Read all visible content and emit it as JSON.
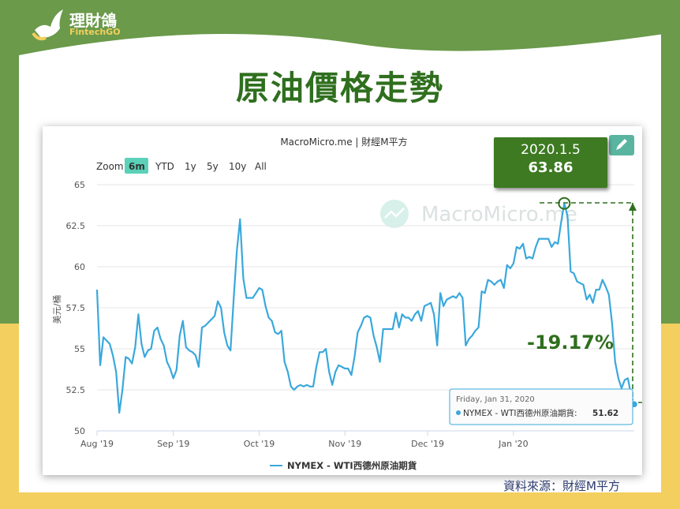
{
  "logo": {
    "name": "理財鴿",
    "sub": "FintechGO"
  },
  "title": "原油價格走勢",
  "source": "資料來源：財經M平方",
  "chart_header": "MacroMicro.me | 財經M平方",
  "watermark": "MacroMicro.me",
  "zoom": {
    "label": "Zoom",
    "options": [
      "6m",
      "YTD",
      "1y",
      "5y",
      "10y",
      "All"
    ],
    "active": "6m"
  },
  "ylabel": "美元/桶",
  "legend": "NYMEX - WTI西德州原油期貨",
  "tooltip": {
    "date": "Friday, Jan 31, 2020",
    "series": "NYMEX - WTI西德州原油期貨:",
    "value": "51.62"
  },
  "callout": {
    "date": "2020.1.5",
    "value": "63.86"
  },
  "change": "-19.17%",
  "colors": {
    "line": "#3aa8dc",
    "accent": "#2f6f1e",
    "callout_bg": "#3d7a22"
  },
  "chart_data": {
    "type": "line",
    "ylim": [
      50,
      65
    ],
    "yticks": [
      "50",
      "52.5",
      "55",
      "57.5",
      "60",
      "62.5",
      "65"
    ],
    "xtick_labels": [
      "Aug '19",
      "Sep '19",
      "Oct '19",
      "Nov '19",
      "Dec '19",
      "Jan '20"
    ],
    "series": [
      {
        "name": "NYMEX - WTI西德州原油期貨",
        "values": [
          58.6,
          54.0,
          55.7,
          55.5,
          55.3,
          54.6,
          53.6,
          51.1,
          52.5,
          54.5,
          54.4,
          54.1,
          55.1,
          57.1,
          55.3,
          54.5,
          54.9,
          55.0,
          56.1,
          56.3,
          55.6,
          55.2,
          54.2,
          53.8,
          53.2,
          53.7,
          55.8,
          56.7,
          55.1,
          54.9,
          54.8,
          54.6,
          53.9,
          56.3,
          56.4,
          56.6,
          56.8,
          57.0,
          57.9,
          57.5,
          56.0,
          55.2,
          54.9,
          58.1,
          61.0,
          62.9,
          59.3,
          58.1,
          58.1,
          58.1,
          58.4,
          58.7,
          58.6,
          57.6,
          56.9,
          56.7,
          56.0,
          55.9,
          56.1,
          54.2,
          53.6,
          52.7,
          52.5,
          52.7,
          52.8,
          52.7,
          52.8,
          52.7,
          52.7,
          53.9,
          54.8,
          54.8,
          55.0,
          53.6,
          52.8,
          53.6,
          54.0,
          53.9,
          53.8,
          53.8,
          53.4,
          54.5,
          56.0,
          56.4,
          56.9,
          57.0,
          56.9,
          55.8,
          55.1,
          54.2,
          56.2,
          56.2,
          56.2,
          56.2,
          57.2,
          56.3,
          57.1,
          56.9,
          56.9,
          56.7,
          57.1,
          57.3,
          56.7,
          57.6,
          57.7,
          57.8,
          57.1,
          55.2,
          58.4,
          57.6,
          58.0,
          58.1,
          58.2,
          58.1,
          58.4,
          58.1,
          55.2,
          55.6,
          55.8,
          56.1,
          56.3,
          58.5,
          58.4,
          59.2,
          59.1,
          58.9,
          59.1,
          59.2,
          58.7,
          60.1,
          59.9,
          60.2,
          61.2,
          61.1,
          61.4,
          60.5,
          60.6,
          60.5,
          61.2,
          61.7,
          61.7,
          61.7,
          61.7,
          61.2,
          61.5,
          61.4,
          62.7,
          63.86,
          63.1,
          59.7,
          59.6,
          59.1,
          59.0,
          58.9,
          58.0,
          58.3,
          57.8,
          58.6,
          58.6,
          59.2,
          58.8,
          58.3,
          56.6,
          54.2,
          53.2,
          52.6,
          53.1,
          53.2,
          52.2,
          51.62
        ]
      }
    ]
  }
}
